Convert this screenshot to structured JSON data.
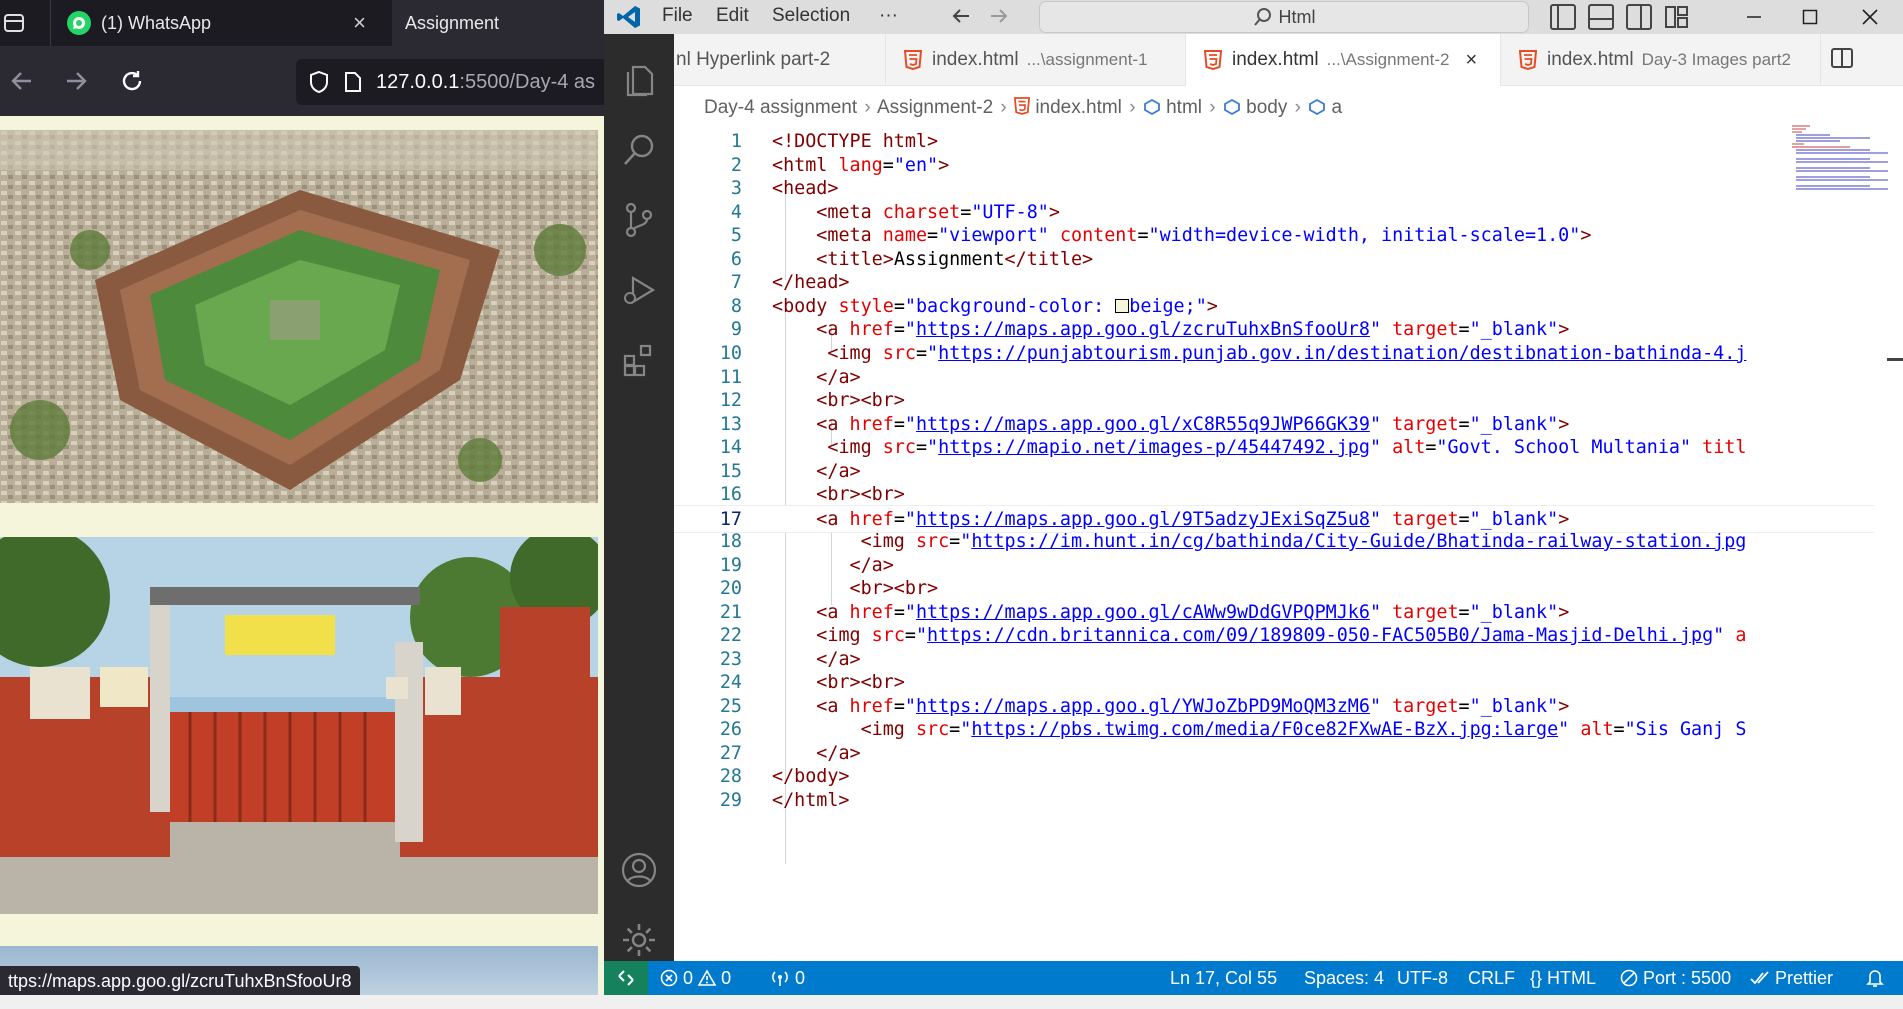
{
  "browser": {
    "tabs": [
      {
        "label": "(1) WhatsApp",
        "close": "×"
      },
      {
        "label": "Assignment"
      }
    ],
    "url": {
      "host": "127.0.0.1",
      "rest": ":5500/Day-4 as"
    },
    "status_url": "ttps://maps.app.goo.gl/zcruTuhxBnSfooUr8",
    "images": [
      {
        "alt": "aerial fort"
      },
      {
        "alt": "Govt. School Multania"
      }
    ]
  },
  "vscode": {
    "menu": [
      "File",
      "Edit",
      "Selection",
      "···"
    ],
    "search": "Html",
    "tabs": [
      {
        "name": "nl Hyperlink part-2",
        "desc": ""
      },
      {
        "name": "index.html",
        "desc": "...\\assignment-1"
      },
      {
        "name": "index.html",
        "desc": "...\\Assignment-2",
        "close": "×"
      },
      {
        "name": "index.html",
        "desc": "Day-3 Images part2"
      }
    ],
    "breadcrumbs": [
      "Day-4 assignment",
      "Assignment-2",
      "index.html",
      "html",
      "body",
      "a"
    ],
    "lines": [
      "1",
      "2",
      "3",
      "4",
      "5",
      "6",
      "7",
      "8",
      "9",
      "10",
      "11",
      "12",
      "13",
      "14",
      "15",
      "16",
      "17",
      "18",
      "19",
      "20",
      "21",
      "22",
      "23",
      "24",
      "25",
      "26",
      "27",
      "28",
      "29"
    ],
    "status": {
      "errors": "0",
      "warnings": "0",
      "ports": "0",
      "position": "Ln 17, Col 55",
      "spaces": "Spaces: 4",
      "encoding": "UTF-8",
      "eol": "CRLF",
      "language": "HTML",
      "port": "Port : 5500",
      "prettier": "Prettier"
    }
  },
  "colors": {
    "status_bar": "#007acc",
    "activity_bar": "#2c2c2c",
    "remote": "#16825d",
    "page_bg": "#f5f5dc"
  }
}
